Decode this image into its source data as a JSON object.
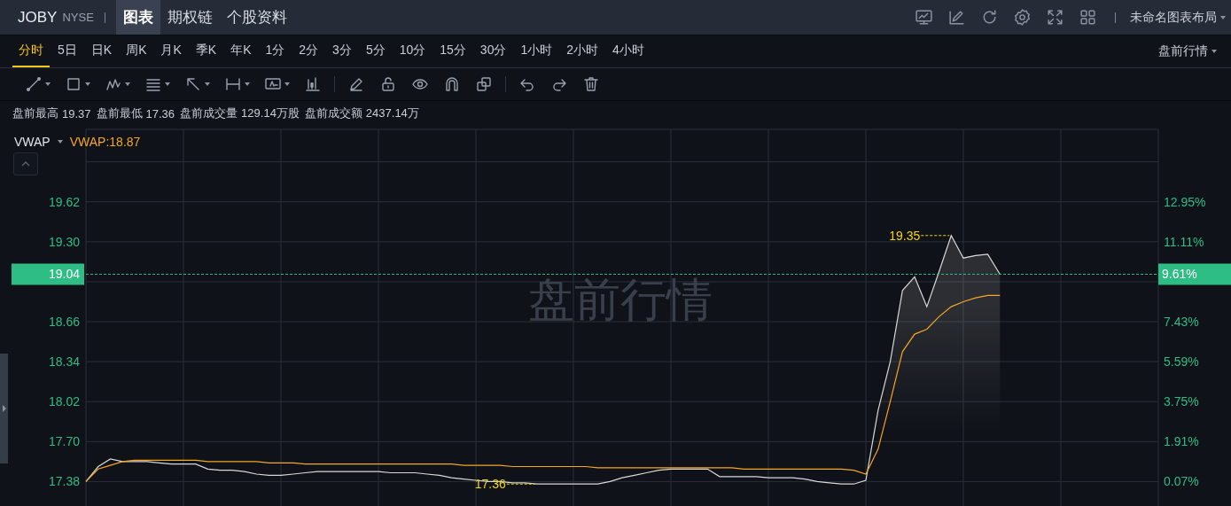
{
  "header": {
    "symbol": "JOBY",
    "exchange": "NYSE",
    "tabs": [
      {
        "label": "图表",
        "selected": true
      },
      {
        "label": "期权链",
        "selected": false
      },
      {
        "label": "个股资料",
        "selected": false
      }
    ],
    "layout_name": "未命名图表布局"
  },
  "timeframes": [
    {
      "label": "分时",
      "selected": true
    },
    {
      "label": "5日",
      "selected": false
    },
    {
      "label": "日K",
      "selected": false
    },
    {
      "label": "周K",
      "selected": false
    },
    {
      "label": "月K",
      "selected": false
    },
    {
      "label": "季K",
      "selected": false
    },
    {
      "label": "年K",
      "selected": false
    },
    {
      "label": "1分",
      "selected": false
    },
    {
      "label": "2分",
      "selected": false
    },
    {
      "label": "3分",
      "selected": false
    },
    {
      "label": "5分",
      "selected": false
    },
    {
      "label": "10分",
      "selected": false
    },
    {
      "label": "15分",
      "selected": false
    },
    {
      "label": "30分",
      "selected": false
    },
    {
      "label": "1小时",
      "selected": false
    },
    {
      "label": "2小时",
      "selected": false
    },
    {
      "label": "4小时",
      "selected": false
    }
  ],
  "session_menu": "盘前行情",
  "stats": [
    {
      "label": "盘前最高",
      "value": "19.37"
    },
    {
      "label": "盘前最低",
      "value": "17.36"
    },
    {
      "label": "盘前成交量",
      "value": "129.14万股"
    },
    {
      "label": "盘前成交额",
      "value": "2437.14万"
    }
  ],
  "chart": {
    "indicator_value": "VWAP:18.87",
    "watermark": "盘前行情",
    "right_axis_labels": [
      "12.95%",
      "11.11%",
      "7.43%",
      "5.59%",
      "3.75%",
      "1.91%",
      "0.07%"
    ],
    "high_marker": "19.35",
    "low_marker": "17.36",
    "last_change": "9.61%",
    "chart_data": {
      "type": "line",
      "ylim": [
        17.17,
        20.2
      ],
      "grid": true,
      "ref_lines": [
        {
          "axis": "y",
          "value": 19.04,
          "label": "19.04",
          "color": "#2ebd85"
        }
      ],
      "categories": [
        null,
        null,
        null,
        null,
        null,
        null,
        null,
        null,
        null,
        null,
        null,
        null,
        null,
        null,
        null,
        null,
        null,
        null,
        null,
        null,
        null,
        null,
        null,
        null,
        null,
        null,
        null,
        null,
        null,
        null,
        null,
        null,
        null,
        null,
        null,
        null,
        null,
        null,
        null,
        null,
        null,
        null,
        null,
        null,
        null,
        null,
        null,
        null,
        null,
        null,
        null,
        null,
        null,
        null,
        null,
        null,
        null,
        null,
        null,
        null,
        null,
        null,
        null,
        null,
        null,
        null,
        null,
        null,
        null,
        null,
        null,
        null,
        null,
        null,
        null,
        null,
        null,
        null,
        null,
        null,
        null,
        null,
        null,
        null,
        null,
        null,
        null,
        null,
        null
      ],
      "series": [
        {
          "color": "#d8d8d8",
          "values": [
            17.38,
            17.5,
            17.56,
            17.54,
            17.54,
            17.54,
            17.53,
            17.52,
            17.52,
            17.52,
            17.48,
            17.47,
            17.47,
            17.46,
            17.44,
            17.43,
            17.43,
            17.44,
            17.45,
            17.46,
            17.46,
            17.46,
            17.46,
            17.46,
            17.46,
            17.45,
            17.45,
            17.45,
            17.44,
            17.43,
            17.41,
            17.4,
            17.39,
            17.38,
            17.38,
            17.37,
            17.37,
            17.36,
            17.36,
            17.36,
            17.36,
            17.36,
            17.36,
            17.38,
            17.41,
            17.43,
            17.45,
            17.47,
            17.48,
            17.48,
            17.48,
            17.48,
            17.42,
            17.42,
            17.42,
            17.42,
            17.41,
            17.41,
            17.41,
            17.4,
            17.38,
            17.37,
            17.36,
            17.36,
            17.39,
            17.95,
            18.34,
            18.91,
            19.02,
            18.78,
            19.06,
            19.35,
            19.17,
            19.19,
            19.2,
            19.04,
            null,
            null,
            null,
            null,
            null,
            null,
            null,
            null,
            null,
            null,
            null,
            null,
            null
          ]
        },
        {
          "name": "VWAP",
          "color": "#f5a623",
          "values": [
            17.38,
            17.48,
            17.51,
            17.54,
            17.55,
            17.55,
            17.55,
            17.55,
            17.55,
            17.55,
            17.54,
            17.54,
            17.54,
            17.54,
            17.54,
            17.53,
            17.53,
            17.53,
            17.52,
            17.52,
            17.52,
            17.52,
            17.52,
            17.52,
            17.52,
            17.52,
            17.52,
            17.52,
            17.52,
            17.52,
            17.52,
            17.51,
            17.51,
            17.51,
            17.51,
            17.5,
            17.5,
            17.5,
            17.5,
            17.5,
            17.5,
            17.5,
            17.49,
            17.49,
            17.49,
            17.49,
            17.49,
            17.49,
            17.49,
            17.49,
            17.49,
            17.49,
            17.49,
            17.49,
            17.48,
            17.48,
            17.48,
            17.48,
            17.48,
            17.48,
            17.48,
            17.48,
            17.48,
            17.47,
            17.44,
            17.64,
            18.02,
            18.42,
            18.56,
            18.6,
            18.7,
            18.78,
            18.82,
            18.85,
            18.87,
            18.87,
            null,
            null,
            null,
            null,
            null,
            null,
            null,
            null,
            null,
            null,
            null,
            null,
            null
          ]
        }
      ],
      "yticks": [
        {
          "value": 19.62,
          "label": "19.62"
        },
        {
          "value": 19.3,
          "label": "19.30"
        },
        {
          "value": 18.66,
          "label": "18.66"
        },
        {
          "value": 18.34,
          "label": "18.34"
        },
        {
          "value": 18.02,
          "label": "18.02"
        },
        {
          "value": 17.7,
          "label": "17.70"
        },
        {
          "value": 17.38,
          "label": "17.38"
        }
      ]
    }
  }
}
